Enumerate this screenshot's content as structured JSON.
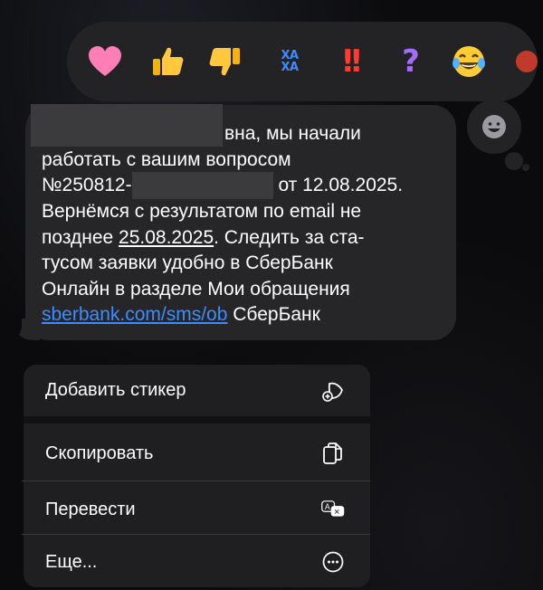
{
  "reactions": [
    {
      "name": "heart",
      "glyph": ""
    },
    {
      "name": "thumbs-up",
      "glyph": ""
    },
    {
      "name": "thumbs-down",
      "glyph": ""
    },
    {
      "name": "haha",
      "glyph": "ХА ХА"
    },
    {
      "name": "exclamation",
      "glyph": "!!"
    },
    {
      "name": "question",
      "glyph": "?"
    },
    {
      "name": "laughing-face",
      "glyph": ""
    }
  ],
  "message": {
    "line1_tail": "вна, мы начали",
    "line2": "работать с вашим вопросом",
    "line3_start": "№250812-",
    "line3_end": "от 12.08.2025.",
    "line4": "Вернёмся с результатом по email не",
    "line5_start": "позднее ",
    "line5_date": "25.08.2025",
    "line5_end": ". Следить за ста-",
    "line6": "тусом заявки удобно в СберБанк",
    "line7": "Онлайн в разделе Мои обращения",
    "link": "sberbank.com/sms/ob",
    "signature": " СберБанк"
  },
  "menu": {
    "add_sticker": "Добавить стикер",
    "copy": "Скопировать",
    "translate": "Перевести",
    "more": "Еще..."
  },
  "colors": {
    "accent": "#3d8cff",
    "bubble": "#262629",
    "menu": "#1f1f21"
  }
}
